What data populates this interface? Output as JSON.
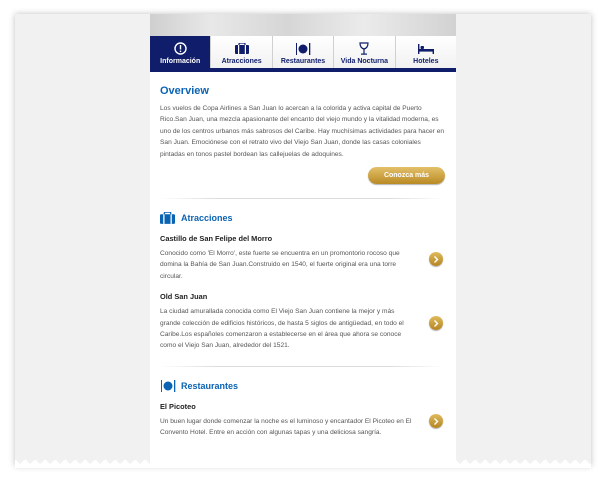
{
  "nav": {
    "tabs": [
      {
        "label": "Información",
        "icon": "info-icon",
        "active": true
      },
      {
        "label": "Atracciones",
        "icon": "attractions-icon",
        "active": false
      },
      {
        "label": "Restaurantes",
        "icon": "restaurants-icon",
        "active": false
      },
      {
        "label": "Vida Nocturna",
        "icon": "nightlife-icon",
        "active": false
      },
      {
        "label": "Hoteles",
        "icon": "hotels-icon",
        "active": false
      }
    ]
  },
  "overview": {
    "title": "Overview",
    "text": "Los vuelos de Copa Airlines a San Juan lo acercan a la colorida y activa capital de Puerto Rico.San Juan, una mezcla apasionante del encanto del viejo mundo y la vitalidad moderna, es uno de los centros urbanos más sabrosos del Caribe. Hay muchísimas actividades para hacer en San Juan. Emociónese con el retrato vivo del Viejo San Juan, donde las casas coloniales pintadas en tonos pastel bordean las callejuelas de adoquines.",
    "button": "Conozca más"
  },
  "attractions": {
    "title": "Atracciones",
    "items": [
      {
        "name": "Castillo de San Felipe del Morro",
        "text": "Conocido como 'El Morro', este fuerte se encuentra en un promontorio rocoso que domina la Bahía de San Juan.Construido en 1540, el fuerte original era una torre circular."
      },
      {
        "name": "Old San Juan",
        "text": "La ciudad amurallada conocida como El Viejo San Juan contiene la mejor y más grande colección de edificios históricos, de hasta 5 siglos de antigüedad, en todo el Caribe.Los españoles comenzaron a establecerse en el área que ahora se conoce como el Viejo San Juan, alrededor del 1521."
      }
    ]
  },
  "restaurants": {
    "title": "Restaurantes",
    "items": [
      {
        "name": "El Picoteo",
        "text": "Un buen lugar donde comenzar la noche es el luminoso y encantador El Picoteo en El Convento Hotel. Entre en acción con algunas tapas y una deliciosa sangría."
      }
    ]
  },
  "colors": {
    "navy": "#0f1d6b",
    "heading_blue": "#0b63b3",
    "gold": "#c9992f"
  }
}
